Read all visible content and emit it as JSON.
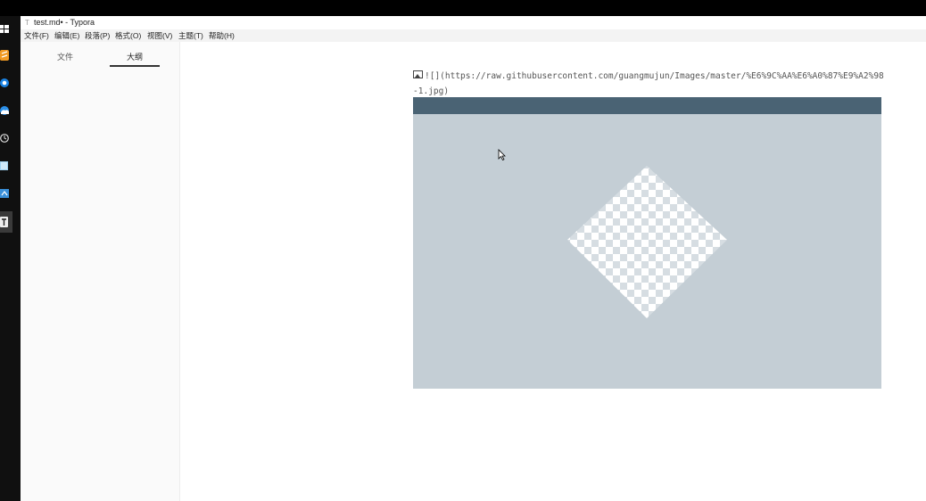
{
  "window": {
    "title": "test.md• - Typora"
  },
  "menubar": {
    "items": [
      "文件(F)",
      "编辑(E)",
      "段落(P)",
      "格式(O)",
      "视图(V)",
      "主题(T)",
      "帮助(H)"
    ]
  },
  "sidebar": {
    "tabs": [
      {
        "label": "文件",
        "active": false
      },
      {
        "label": "大纲",
        "active": true
      }
    ]
  },
  "editor": {
    "markdown_source": "![](https://raw.githubusercontent.com/guangmujun/Images/master/%E6%9C%AA%E6%A0%87%E9%A2%98-1.jpg)"
  },
  "image_preview": {
    "background_color": "#c4ced5",
    "header_bar_color": "#4a6374",
    "pattern": "checkerboard-diamond"
  },
  "taskbar": {
    "icons": [
      "windows-start-icon",
      "sublime-icon",
      "browser-icon",
      "cloud-icon",
      "clock-icon",
      "photo-icon",
      "terminal-icon",
      "typora-icon"
    ]
  }
}
